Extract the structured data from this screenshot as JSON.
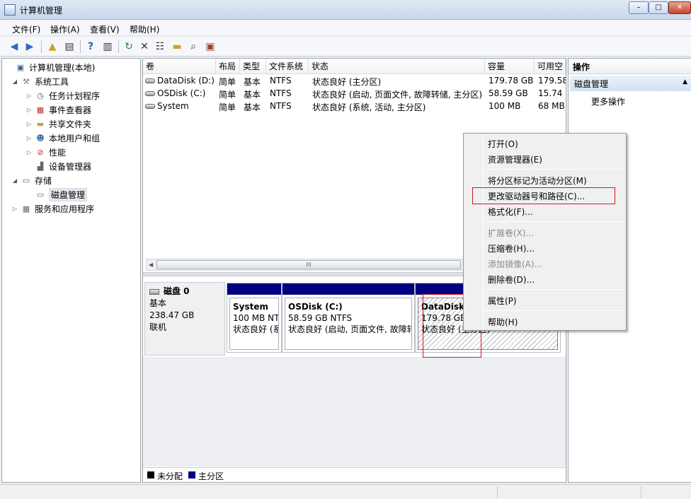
{
  "window": {
    "title": "计算机管理",
    "controls": {
      "minimize": "–",
      "maximize": "□",
      "close": "✕"
    }
  },
  "menu": [
    "文件(F)",
    "操作(A)",
    "查看(V)",
    "帮助(H)"
  ],
  "toolbar": {
    "icons": [
      "back-arrow-icon",
      "forward-arrow-icon",
      "up-folder-icon",
      "show-hide-tree-icon",
      "help-icon",
      "action-pane-icon",
      "refresh-icon",
      "delete-icon",
      "properties-icon",
      "open-folder-icon",
      "search-icon",
      "shortcut-icon"
    ]
  },
  "tree": [
    {
      "label": "计算机管理(本地)",
      "expander": "",
      "icon": "computer-icon"
    },
    {
      "label": "系统工具",
      "expander": "◢",
      "icon": "tools-icon"
    },
    {
      "label": "任务计划程序",
      "expander": "▷",
      "icon": "clock-icon"
    },
    {
      "label": "事件查看器",
      "expander": "▷",
      "icon": "event-viewer-icon"
    },
    {
      "label": "共享文件夹",
      "expander": "▷",
      "icon": "shared-folder-icon"
    },
    {
      "label": "本地用户和组",
      "expander": "▷",
      "icon": "users-icon"
    },
    {
      "label": "性能",
      "expander": "▷",
      "icon": "performance-icon"
    },
    {
      "label": "设备管理器",
      "expander": "",
      "icon": "device-manager-icon"
    },
    {
      "label": "存储",
      "expander": "◢",
      "icon": "storage-icon"
    },
    {
      "label": "磁盘管理",
      "expander": "",
      "icon": "disk-management-icon"
    },
    {
      "label": "服务和应用程序",
      "expander": "▷",
      "icon": "services-icon"
    }
  ],
  "volumes": {
    "headers": [
      "卷",
      "布局",
      "类型",
      "文件系统",
      "状态",
      "容量",
      "可用空"
    ],
    "rows": [
      [
        "DataDisk (D:)",
        "简单",
        "基本",
        "NTFS",
        "状态良好 (主分区)",
        "179.78 GB",
        "179.58"
      ],
      [
        "OSDisk (C:)",
        "简单",
        "基本",
        "NTFS",
        "状态良好 (启动, 页面文件, 故障转储, 主分区)",
        "58.59 GB",
        "15.74"
      ],
      [
        "System",
        "简单",
        "基本",
        "NTFS",
        "状态良好 (系统, 活动, 主分区)",
        "100 MB",
        "68 MB"
      ]
    ],
    "scroll_grip": "III"
  },
  "disk": {
    "name": "磁盘 0",
    "type": "基本",
    "size": "238.47 GB",
    "status": "联机",
    "partitions": [
      {
        "name": "System",
        "line2": "100 MB NTFS",
        "line3": "状态良好 (系统, 活动, 主分区)"
      },
      {
        "name": "OSDisk  (C:)",
        "line2": "58.59 GB NTFS",
        "line3": "状态良好 (启动, 页面文件, 故障转储, 主分区)"
      },
      {
        "name": "DataDisk",
        "line2": "179.78 GB",
        "line3": "状态良好 (主分区)"
      }
    ]
  },
  "legend": [
    {
      "label": "未分配",
      "color": "#000000"
    },
    {
      "label": "主分区",
      "color": "#000080"
    }
  ],
  "actions": {
    "header": "操作",
    "section": "磁盘管理",
    "section_arrow": "▲",
    "more": "更多操作",
    "more_arrow": "▶"
  },
  "context_menu": {
    "items": [
      {
        "label": "打开(O)",
        "enabled": true
      },
      {
        "label": "资源管理器(E)",
        "enabled": true
      },
      {
        "label": "将分区标记为活动分区(M)",
        "enabled": true
      },
      {
        "label": "更改驱动器号和路径(C)...",
        "enabled": true,
        "highlighted": true
      },
      {
        "label": "格式化(F)...",
        "enabled": true
      },
      {
        "label": "扩展卷(X)...",
        "enabled": false
      },
      {
        "label": "压缩卷(H)...",
        "enabled": true
      },
      {
        "label": "添加镜像(A)...",
        "enabled": false
      },
      {
        "label": "删除卷(D)...",
        "enabled": true
      },
      {
        "label": "属性(P)",
        "enabled": true
      },
      {
        "label": "帮助(H)",
        "enabled": true
      }
    ]
  },
  "colors": {
    "primary_partition": "#000080",
    "annotation_red": "#d11a1a"
  }
}
